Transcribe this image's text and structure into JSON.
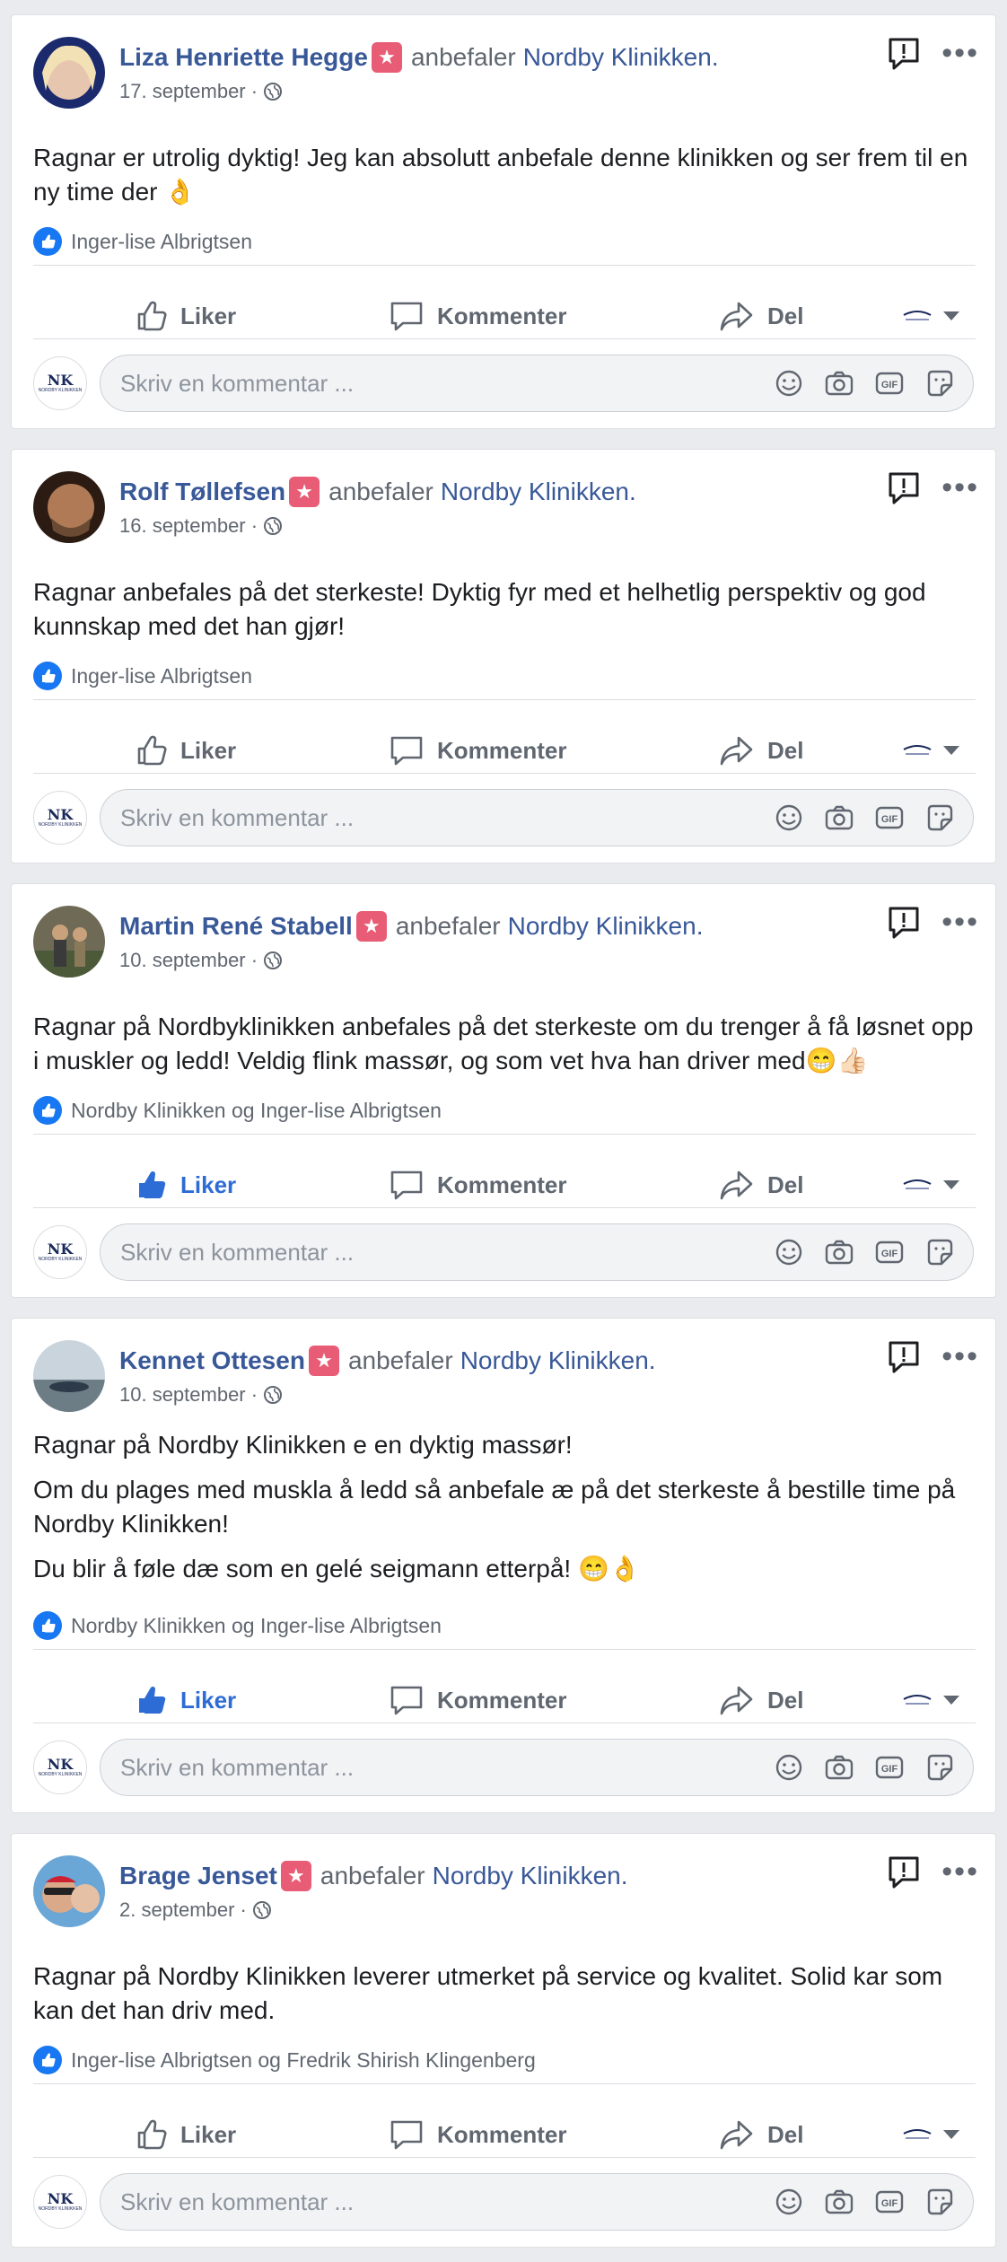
{
  "page_name": "Nordby Klinikken.",
  "rec_text": "anbefaler",
  "actions": {
    "like": "Liker",
    "comment": "Kommenter",
    "share": "Del"
  },
  "comment_placeholder": "Skriv en kommentar ...",
  "page_avatar": {
    "mark": "NK",
    "sub": "NORDBY KLINIKKEN"
  },
  "colors": {
    "link": "#385898",
    "liked": "#2d6bd5",
    "star_badge": "#e85c75",
    "background": "#e9ebee"
  },
  "posts": [
    {
      "author": "Liza Henriette Hegge",
      "date": "17. september ·",
      "text": [
        "Ragnar er utrolig dyktig! Jeg kan absolutt anbefale denne klinikken og ser frem til en ny time der 👌"
      ],
      "likes": "Inger-lise Albrigtsen",
      "liked": false
    },
    {
      "author": "Rolf Tøllefsen",
      "date": "16. september ·",
      "text": [
        "Ragnar anbefales på det sterkeste! Dyktig fyr med et helhetlig perspektiv og god kunnskap med det han gjør!"
      ],
      "likes": "Inger-lise Albrigtsen",
      "liked": false
    },
    {
      "author": "Martin René Stabell",
      "date": "10. september ·",
      "text": [
        "Ragnar på Nordbyklinikken anbefales på det sterkeste om du trenger å få løsnet opp i muskler og ledd! Veldig flink massør, og som vet hva han driver med😁👍🏻"
      ],
      "likes": "Nordby Klinikken og Inger-lise Albrigtsen",
      "liked": true
    },
    {
      "author": "Kennet Ottesen",
      "date": "10. september ·",
      "text": [
        "Ragnar på Nordby Klinikken e en dyktig massør!",
        "Om du plages med muskla å ledd så anbefale æ på det sterkeste å bestille time på Nordby Klinikken!",
        "Du blir å føle dæ som en gelé seigmann etterpå! 😁👌"
      ],
      "likes": "Nordby Klinikken og Inger-lise Albrigtsen",
      "liked": true
    },
    {
      "author": "Brage Jenset",
      "date": "2. september ·",
      "text": [
        "Ragnar på Nordby Klinikken leverer utmerket på service og kvalitet. Solid kar som kan det han driv med."
      ],
      "likes": "Inger-lise Albrigtsen og Fredrik Shirish Klingenberg",
      "liked": false
    }
  ]
}
